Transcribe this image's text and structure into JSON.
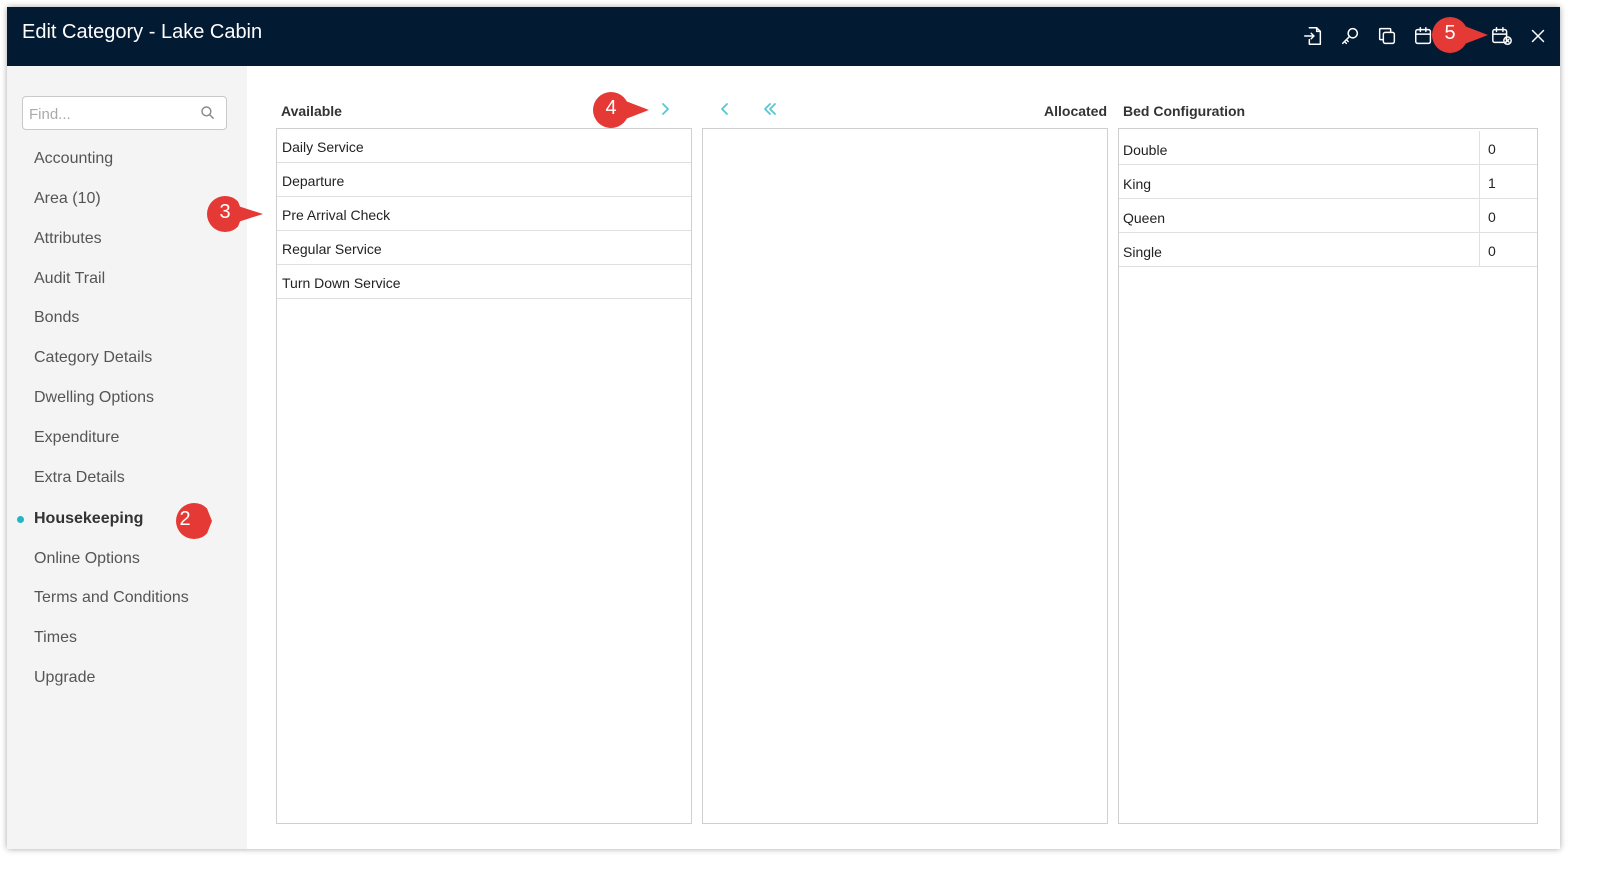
{
  "window": {
    "title": "Edit Category - Lake Cabin"
  },
  "toolbar": {
    "icons": [
      "import-icon",
      "key-icon",
      "copy-icon",
      "calendar-icon",
      "calendar-cancel-icon",
      "close-icon"
    ]
  },
  "sidebar": {
    "search": {
      "placeholder": "Find..."
    },
    "items": [
      {
        "label": "Accounting"
      },
      {
        "label": "Area (10)"
      },
      {
        "label": "Attributes"
      },
      {
        "label": "Audit Trail"
      },
      {
        "label": "Bonds"
      },
      {
        "label": "Category Details"
      },
      {
        "label": "Dwelling Options"
      },
      {
        "label": "Expenditure"
      },
      {
        "label": "Extra Details"
      },
      {
        "label": "Housekeeping",
        "active": true
      },
      {
        "label": "Online Options"
      },
      {
        "label": "Terms and Conditions"
      },
      {
        "label": "Times"
      },
      {
        "label": "Upgrade"
      }
    ]
  },
  "housekeeping": {
    "available_header": "Available",
    "allocated_header": "Allocated",
    "available_items": [
      "Daily Service",
      "Departure",
      "Pre Arrival Check",
      "Regular Service",
      "Turn Down Service"
    ],
    "allocated_items": []
  },
  "bed_configuration": {
    "header": "Bed Configuration",
    "rows": [
      {
        "type": "Double",
        "count": "0"
      },
      {
        "type": "King",
        "count": "1"
      },
      {
        "type": "Queen",
        "count": "0"
      },
      {
        "type": "Single",
        "count": "0"
      }
    ]
  },
  "callouts": [
    "2",
    "3",
    "4",
    "5"
  ],
  "colors": {
    "titlebar": "#031a33",
    "accent": "#1fb6c9",
    "arrow": "#56c7d3",
    "callout": "#e53935"
  }
}
